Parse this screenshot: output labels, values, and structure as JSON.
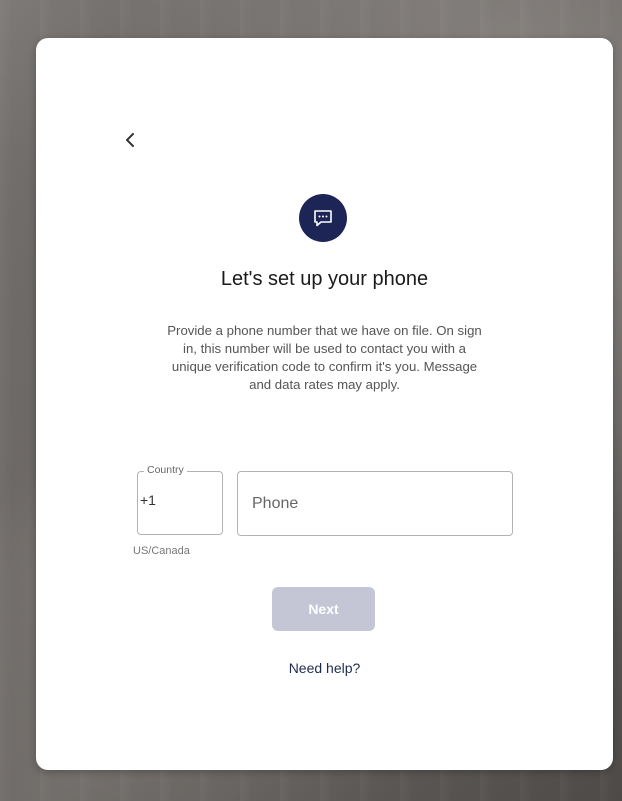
{
  "header": {
    "back_icon": "chevron-left-icon"
  },
  "hero": {
    "icon": "message-bubble-icon",
    "icon_bg_color": "#1d2456"
  },
  "title": "Let's set up your phone",
  "description": "Provide a phone number that we have on file. On sign in, this number will be used to contact you with a unique verification code to confirm it's you. Message and data rates may apply.",
  "country": {
    "label": "Country",
    "value": "+1",
    "helper": "US/Canada"
  },
  "phone": {
    "placeholder": "Phone",
    "value": ""
  },
  "actions": {
    "next_label": "Next",
    "next_disabled": true,
    "next_color": "#c4c6d6",
    "help_label": "Need help?"
  }
}
